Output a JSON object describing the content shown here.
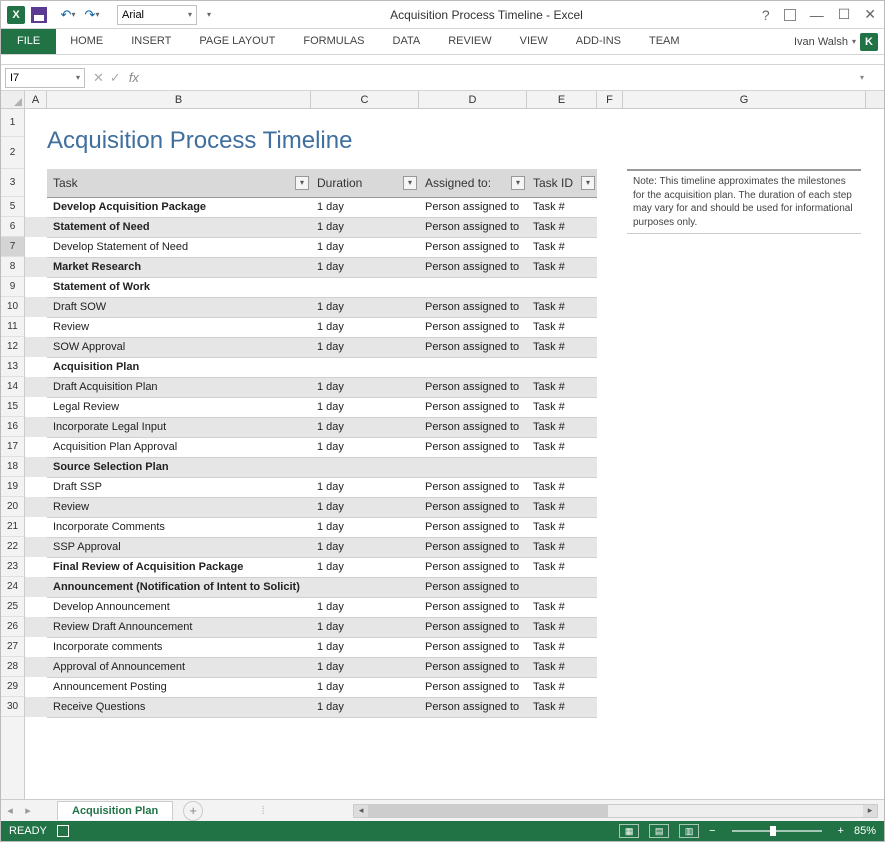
{
  "app": {
    "title": "Acquisition Process Timeline - Excel",
    "font_selector": "Arial",
    "user": "Ivan Walsh",
    "user_initial": "K"
  },
  "ribbon": {
    "file": "FILE",
    "tabs": [
      "HOME",
      "INSERT",
      "PAGE LAYOUT",
      "FORMULAS",
      "DATA",
      "REVIEW",
      "VIEW",
      "ADD-INS",
      "TEAM"
    ]
  },
  "formula": {
    "name_box": "I7",
    "fx": "fx",
    "value": ""
  },
  "columns": [
    "A",
    "B",
    "C",
    "D",
    "E",
    "F",
    "G"
  ],
  "row_numbers": [
    1,
    2,
    3,
    5,
    6,
    7,
    8,
    9,
    10,
    11,
    12,
    13,
    14,
    15,
    16,
    17,
    18,
    19,
    20,
    21,
    22,
    23,
    24,
    25,
    26,
    27,
    28,
    29,
    30
  ],
  "sheet_title": "Acquisition Process Timeline",
  "headers": {
    "task": "Task",
    "duration": "Duration",
    "assigned": "Assigned to:",
    "taskid": "Task ID"
  },
  "rows": [
    {
      "task": "Develop Acquisition Package",
      "dur": "1 day",
      "asg": "Person assigned to",
      "tid": "Task #",
      "sec": true,
      "shade": false
    },
    {
      "task": "Statement of Need",
      "dur": "1 day",
      "asg": "Person assigned to",
      "tid": "Task #",
      "sec": true,
      "shade": true
    },
    {
      "task": "Develop Statement of Need",
      "dur": "1 day",
      "asg": "Person assigned to",
      "tid": "Task #",
      "sec": false,
      "shade": false
    },
    {
      "task": "Market Research",
      "dur": "1 day",
      "asg": "Person assigned to",
      "tid": "Task #",
      "sec": true,
      "shade": true
    },
    {
      "task": "Statement of Work",
      "dur": "",
      "asg": "",
      "tid": "",
      "sec": true,
      "shade": false
    },
    {
      "task": "Draft SOW",
      "dur": "1 day",
      "asg": "Person assigned to",
      "tid": "Task #",
      "sec": false,
      "shade": true
    },
    {
      "task": "Review",
      "dur": "1 day",
      "asg": "Person assigned to",
      "tid": "Task #",
      "sec": false,
      "shade": false
    },
    {
      "task": "SOW Approval",
      "dur": "1 day",
      "asg": "Person assigned to",
      "tid": "Task #",
      "sec": false,
      "shade": true
    },
    {
      "task": "Acquisition Plan",
      "dur": "",
      "asg": "",
      "tid": "",
      "sec": true,
      "shade": false
    },
    {
      "task": "Draft Acquisition Plan",
      "dur": "1 day",
      "asg": "Person assigned to",
      "tid": "Task #",
      "sec": false,
      "shade": true
    },
    {
      "task": "Legal Review",
      "dur": "1 day",
      "asg": "Person assigned to",
      "tid": "Task #",
      "sec": false,
      "shade": false
    },
    {
      "task": "Incorporate Legal Input",
      "dur": "1 day",
      "asg": "Person assigned to",
      "tid": "Task #",
      "sec": false,
      "shade": true
    },
    {
      "task": "Acquisition Plan Approval",
      "dur": "1 day",
      "asg": "Person assigned to",
      "tid": "Task #",
      "sec": false,
      "shade": false
    },
    {
      "task": "Source Selection Plan",
      "dur": "",
      "asg": "",
      "tid": "",
      "sec": true,
      "shade": true
    },
    {
      "task": "Draft SSP",
      "dur": "1 day",
      "asg": "Person assigned to",
      "tid": "Task #",
      "sec": false,
      "shade": false
    },
    {
      "task": "Review",
      "dur": "1 day",
      "asg": "Person assigned to",
      "tid": "Task #",
      "sec": false,
      "shade": true
    },
    {
      "task": "Incorporate Comments",
      "dur": "1 day",
      "asg": "Person assigned to",
      "tid": "Task #",
      "sec": false,
      "shade": false
    },
    {
      "task": "SSP Approval",
      "dur": "1 day",
      "asg": "Person assigned to",
      "tid": "Task #",
      "sec": false,
      "shade": true
    },
    {
      "task": "Final Review of Acquisition Package",
      "dur": "1 day",
      "asg": "Person assigned to",
      "tid": "Task #",
      "sec": true,
      "shade": false
    },
    {
      "task": "Announcement (Notification of Intent to Solicit)",
      "dur": "",
      "asg": "Person assigned to",
      "tid": "",
      "sec": true,
      "shade": true
    },
    {
      "task": "Develop Announcement",
      "dur": "1 day",
      "asg": "Person assigned to",
      "tid": "Task #",
      "sec": false,
      "shade": false
    },
    {
      "task": "Review Draft Announcement",
      "dur": "1 day",
      "asg": "Person assigned to",
      "tid": "Task #",
      "sec": false,
      "shade": true
    },
    {
      "task": "Incorporate comments",
      "dur": "1 day",
      "asg": "Person assigned to",
      "tid": "Task #",
      "sec": false,
      "shade": false
    },
    {
      "task": "Approval of Announcement",
      "dur": "1 day",
      "asg": "Person assigned to",
      "tid": "Task #",
      "sec": false,
      "shade": true
    },
    {
      "task": "Announcement Posting",
      "dur": "1 day",
      "asg": "Person assigned to",
      "tid": "Task #",
      "sec": false,
      "shade": false
    },
    {
      "task": "Receive Questions",
      "dur": "1 day",
      "asg": "Person assigned to",
      "tid": "Task #",
      "sec": false,
      "shade": true
    }
  ],
  "note": "Note: This timeline approximates the milestones for the acquisition plan. The duration of each step may vary for and should be used for informational purposes only.",
  "sheet": {
    "active_tab": "Acquisition Plan"
  },
  "status": {
    "ready": "READY",
    "zoom": "85%"
  }
}
